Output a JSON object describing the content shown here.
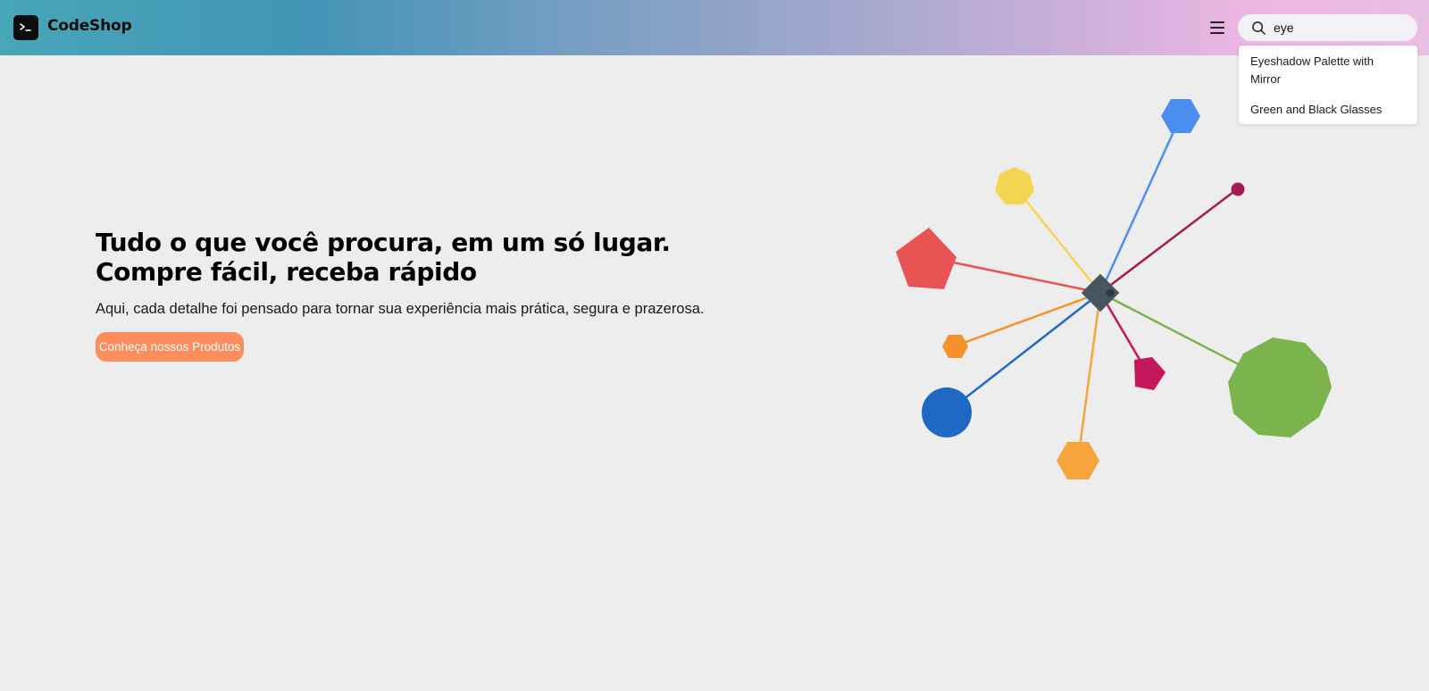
{
  "header": {
    "brand": "CodeShop",
    "logo_icon": "terminal-icon",
    "menu_icon": "hamburger-menu-icon"
  },
  "search": {
    "value": "eye",
    "icon": "search-icon",
    "suggestions": [
      "Eyeshadow Palette with Mirror",
      "Green and Black Glasses"
    ]
  },
  "hero": {
    "title": "Tudo o que você procura, em um só lugar. Compre fácil, receba rápido",
    "subtitle": "Aqui, cada detalhe foi pensado para tornar sua experiência mais prática, segura e prazerosa.",
    "cta_label": "Conheça nossos Produtos"
  },
  "colors": {
    "cta": "#fe8d5e",
    "page_bg": "#ededed",
    "hub": "#475560",
    "shapes": [
      "#4a8ef0",
      "#f6d552",
      "#a31a55",
      "#e85454",
      "#f7912a",
      "#1f68c4",
      "#f6a43c",
      "#c4165a",
      "#7bb34c"
    ]
  }
}
